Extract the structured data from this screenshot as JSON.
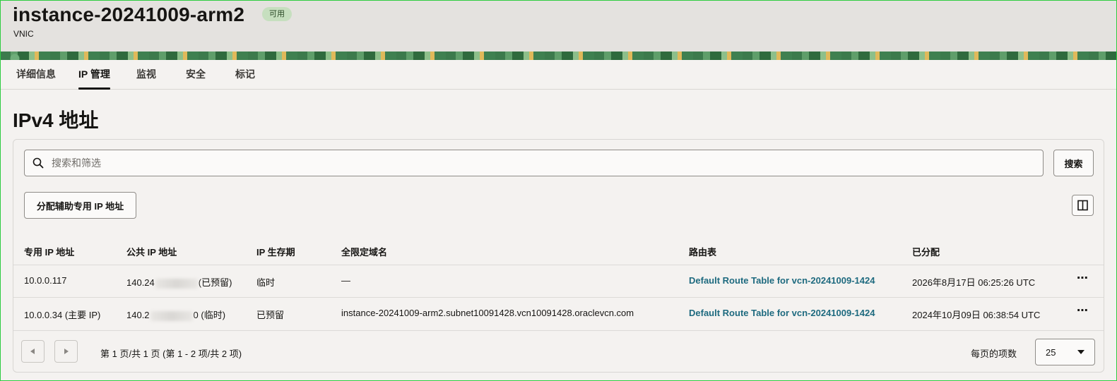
{
  "header": {
    "title": "instance-20241009-arm2",
    "status": "可用",
    "subtitle": "VNIC"
  },
  "tabs": [
    {
      "label": "详细信息"
    },
    {
      "label": "IP 管理"
    },
    {
      "label": "监视"
    },
    {
      "label": "安全"
    },
    {
      "label": "标记"
    }
  ],
  "section": {
    "title": "IPv4 地址"
  },
  "search": {
    "placeholder": "搜索和筛选",
    "button_label": "搜索"
  },
  "actions": {
    "assign_label": "分配辅助专用 IP 地址"
  },
  "table": {
    "headers": [
      "专用 IP 地址",
      "公共 IP 地址",
      "IP 生存期",
      "全限定域名",
      "路由表",
      "已分配"
    ],
    "rows": [
      {
        "private_ip": "10.0.0.117",
        "public_ip_prefix": "140.24",
        "public_ip_suffix": "(已预留)",
        "lifetime": "临时",
        "fqdn": "—",
        "route_table": "Default Route Table for vcn-20241009-1424",
        "assigned": "2026年8月17日 06:25:26 UTC"
      },
      {
        "private_ip": "10.0.0.34 (主要 IP)",
        "public_ip_prefix": "140.2",
        "public_ip_suffix": "0 (临时)",
        "lifetime": "已预留",
        "fqdn": "instance-20241009-arm2.subnet10091428.vcn10091428.oraclevcn.com",
        "route_table": "Default Route Table for vcn-20241009-1424",
        "assigned": "2024年10月09日 06:38:54 UTC"
      }
    ]
  },
  "pagination": {
    "summary": "第 1 页/共 1 页 (第 1 - 2 项/共 2 项)",
    "per_page_label": "每页的项数",
    "per_page_value": "25"
  }
}
